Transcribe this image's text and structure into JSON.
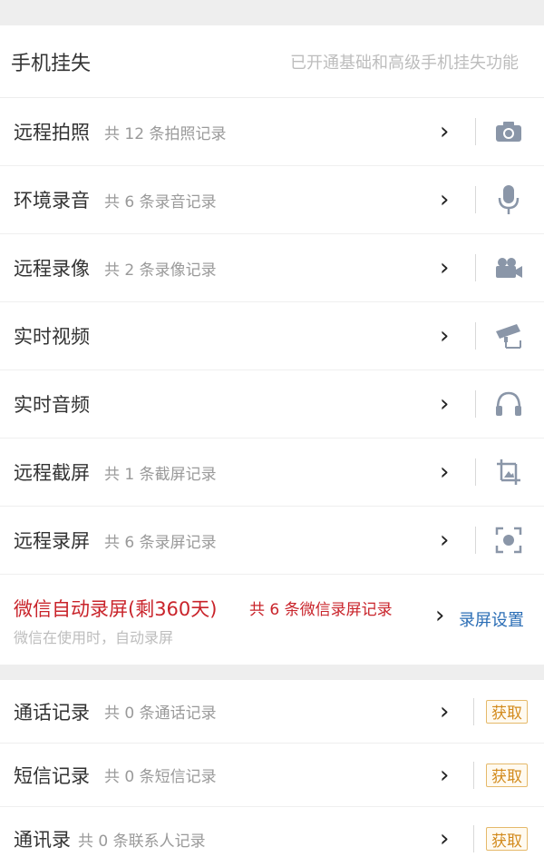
{
  "header": {
    "title": "手机挂失",
    "status": "已开通基础和高级手机挂失功能"
  },
  "features": [
    {
      "title": "远程拍照",
      "sub": "共 12 条拍照记录",
      "icon": "camera-icon"
    },
    {
      "title": "环境录音",
      "sub": "共 6 条录音记录",
      "icon": "microphone-icon"
    },
    {
      "title": "远程录像",
      "sub": "共 2 条录像记录",
      "icon": "video-camera-icon"
    },
    {
      "title": "实时视频",
      "sub": "",
      "icon": "surveillance-camera-icon"
    },
    {
      "title": "实时音频",
      "sub": "",
      "icon": "headphones-icon"
    },
    {
      "title": "远程截屏",
      "sub": "共 1 条截屏记录",
      "icon": "crop-icon"
    },
    {
      "title": "远程录屏",
      "sub": "共 6 条录屏记录",
      "icon": "screen-record-icon"
    }
  ],
  "wechat": {
    "title": "微信自动录屏(剩360天)",
    "count": "共 6 条微信录屏记录",
    "note": "微信在使用时，自动录屏",
    "link": "录屏设置"
  },
  "records": [
    {
      "title": "通话记录",
      "sub": "共 0 条通话记录",
      "action": "获取"
    },
    {
      "title": "短信记录",
      "sub": "共 0 条短信记录",
      "action": "获取"
    },
    {
      "title": "通讯录",
      "sub": "共 0 条联系人记录",
      "action": "获取"
    }
  ],
  "chevron": "›",
  "colors": {
    "accent_red": "#c9242b",
    "link_blue": "#2a6db5",
    "get_orange": "#d28a1c",
    "icon_gray": "#8a96a8"
  }
}
